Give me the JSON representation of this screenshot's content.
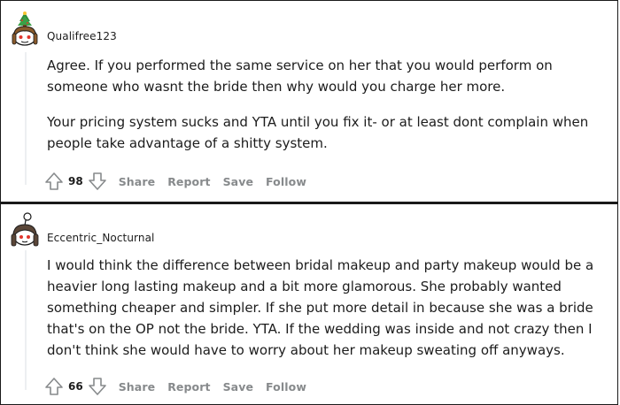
{
  "comments": [
    {
      "username": "Qualifree123",
      "avatar_icon": "snoo-avatar-christmas-tree-hat",
      "paragraphs": [
        "Agree. If you performed the same service on her that you would perform on someone who wasnt the bride then why would you charge her more.",
        "Your pricing system sucks and YTA until you fix it- or at least dont complain when people take advantage of a shitty system."
      ],
      "votes": "98",
      "actions": {
        "share": "Share",
        "report": "Report",
        "save": "Save",
        "follow": "Follow"
      }
    },
    {
      "username": "Eccentric_Nocturnal",
      "avatar_icon": "snoo-avatar-hair-bun",
      "paragraphs": [
        "I would think the difference between bridal makeup and party makeup would be a heavier long lasting makeup and a bit more glamorous. She probably wanted something cheaper and simpler. If she put more detail in because she was a bride that's on the OP not the bride. YTA. If the wedding was inside and not crazy then I don't think she would have to worry about her makeup sweating off anyways."
      ],
      "votes": "66",
      "actions": {
        "share": "Share",
        "report": "Report",
        "save": "Save",
        "follow": "Follow"
      }
    }
  ],
  "colors": {
    "action_text": "#878a8c",
    "thread_line": "#edeff1",
    "border": "#1a1a1a"
  }
}
